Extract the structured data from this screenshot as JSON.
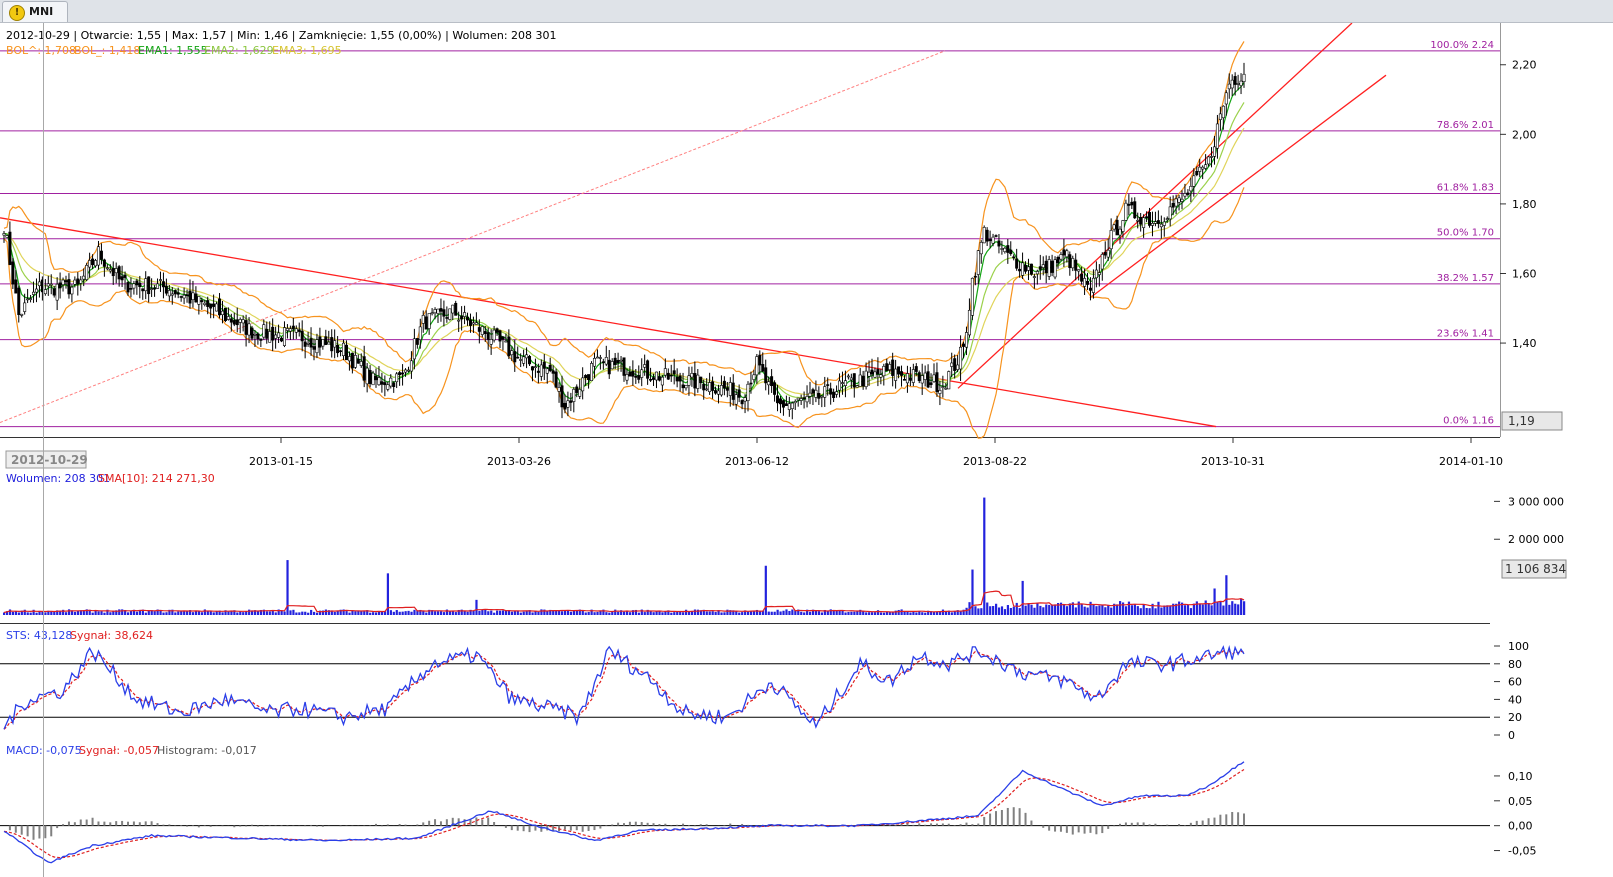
{
  "tab": {
    "label": "MNI",
    "icon": "warning-icon"
  },
  "colors": {
    "bol": "#f7931e",
    "ema1": "#13a313",
    "ema2": "#9bd14b",
    "ema3": "#e0d45a",
    "fib": "#a020a0",
    "trend": "#ff2020",
    "volume": "#2222dd",
    "sma": "#e02020",
    "sts": "#2a3ee8",
    "signal": "#e02020",
    "hist": "#808080"
  },
  "price_info": {
    "line1": "2012-10-29 | Otwarcie: 1,55 | Max: 1,57 | Min: 1,46 | Zamknięcie: 1,55 (0,00%) | Wolumen: 208 301",
    "bol_up": "BOL^: 1,708",
    "bol_down": "BOL_: 1,418",
    "ema1": "EMA1: 1,555",
    "ema2": "EMA2: 1,629",
    "ema3": "EMA3: 1,695"
  },
  "volume_info": {
    "volume": "Wolumen: 208 301",
    "sma": "SMA[10]: 214 271,30"
  },
  "sts_info": {
    "sts": "STS: 43,128",
    "signal": "Sygnał: 38,624"
  },
  "macd_info": {
    "macd": "MACD: -0,075",
    "signal": "Sygnał: -0,057",
    "histogram": "Histogram: -0,017"
  },
  "cursor_date": "2012-10-29",
  "price_marker": "1,19",
  "volume_marker": "1 106 834",
  "chart_data": [
    {
      "type": "candlestick",
      "name": "price",
      "x_ticks": [
        "2013-01-15",
        "2013-03-26",
        "2013-06-12",
        "2013-08-22",
        "2013-10-31",
        "2014-01-10"
      ],
      "y_ticks": [
        "1,40",
        "1,60",
        "1,80",
        "2,00",
        "2,20"
      ],
      "ylim": [
        1.13,
        2.32
      ],
      "fib_levels": [
        {
          "label": "100.0% 2.24",
          "value": 2.24
        },
        {
          "label": "78.6% 2.01",
          "value": 2.01
        },
        {
          "label": "61.8% 1.83",
          "value": 1.83
        },
        {
          "label": "50.0% 1.70",
          "value": 1.7
        },
        {
          "label": "38.2% 1.57",
          "value": 1.57
        },
        {
          "label": "23.6% 1.41",
          "value": 1.41
        },
        {
          "label": "0.0% 1.16",
          "value": 1.16
        }
      ],
      "close_keyframes": [
        [
          0,
          1.74
        ],
        [
          5,
          1.48
        ],
        [
          12,
          1.56
        ],
        [
          25,
          1.56
        ],
        [
          32,
          1.66
        ],
        [
          40,
          1.57
        ],
        [
          55,
          1.56
        ],
        [
          70,
          1.5
        ],
        [
          85,
          1.43
        ],
        [
          100,
          1.42
        ],
        [
          115,
          1.38
        ],
        [
          125,
          1.29
        ],
        [
          135,
          1.3
        ],
        [
          142,
          1.46
        ],
        [
          152,
          1.49
        ],
        [
          165,
          1.42
        ],
        [
          175,
          1.35
        ],
        [
          185,
          1.32
        ],
        [
          190,
          1.22
        ],
        [
          200,
          1.34
        ],
        [
          210,
          1.33
        ],
        [
          225,
          1.3
        ],
        [
          240,
          1.28
        ],
        [
          250,
          1.25
        ],
        [
          255,
          1.34
        ],
        [
          262,
          1.22
        ],
        [
          275,
          1.24
        ],
        [
          285,
          1.28
        ],
        [
          300,
          1.32
        ],
        [
          310,
          1.3
        ],
        [
          318,
          1.28
        ],
        [
          325,
          1.38
        ],
        [
          328,
          1.58
        ],
        [
          332,
          1.72
        ],
        [
          340,
          1.65
        ],
        [
          350,
          1.6
        ],
        [
          360,
          1.65
        ],
        [
          368,
          1.54
        ],
        [
          373,
          1.67
        ],
        [
          380,
          1.78
        ],
        [
          390,
          1.75
        ],
        [
          400,
          1.82
        ],
        [
          408,
          1.92
        ],
        [
          415,
          2.15
        ],
        [
          420,
          2.18
        ]
      ],
      "notes": [
        "BOL",
        "EMA1",
        "EMA2",
        "EMA3",
        "trend lines"
      ]
    },
    {
      "type": "bar",
      "name": "volume",
      "y_ticks": [
        "2 000 000",
        "3 000 000"
      ],
      "ylim": [
        0,
        3300000
      ],
      "spikes": [
        [
          96,
          1450000
        ],
        [
          130,
          1100000
        ],
        [
          160,
          400000
        ],
        [
          258,
          1300000
        ],
        [
          328,
          1200000
        ],
        [
          332,
          3100000
        ],
        [
          345,
          900000
        ],
        [
          410,
          700000
        ],
        [
          414,
          1050000
        ]
      ]
    },
    {
      "type": "line",
      "name": "STS",
      "y_ticks": [
        "0",
        "20",
        "40",
        "60",
        "80",
        "100"
      ],
      "ylim": [
        0,
        100
      ],
      "levels": [
        20,
        80
      ],
      "keyframes": [
        [
          0,
          10
        ],
        [
          8,
          40
        ],
        [
          20,
          50
        ],
        [
          30,
          95
        ],
        [
          45,
          40
        ],
        [
          60,
          25
        ],
        [
          75,
          40
        ],
        [
          90,
          25
        ],
        [
          100,
          30
        ],
        [
          115,
          20
        ],
        [
          130,
          30
        ],
        [
          145,
          80
        ],
        [
          160,
          90
        ],
        [
          172,
          40
        ],
        [
          185,
          30
        ],
        [
          195,
          20
        ],
        [
          205,
          95
        ],
        [
          220,
          60
        ],
        [
          230,
          25
        ],
        [
          245,
          20
        ],
        [
          260,
          60
        ],
        [
          275,
          10
        ],
        [
          290,
          80
        ],
        [
          300,
          60
        ],
        [
          310,
          90
        ],
        [
          320,
          80
        ],
        [
          330,
          95
        ],
        [
          345,
          70
        ],
        [
          360,
          60
        ],
        [
          370,
          40
        ],
        [
          380,
          80
        ],
        [
          395,
          80
        ],
        [
          410,
          90
        ],
        [
          415,
          95
        ],
        [
          420,
          88
        ]
      ]
    },
    {
      "type": "line",
      "name": "MACD",
      "y_ticks": [
        "-0,05",
        "0,00",
        "0,05",
        "0,10"
      ],
      "ylim": [
        -0.075,
        0.13
      ],
      "keyframes": [
        [
          0,
          -0.01
        ],
        [
          15,
          -0.075
        ],
        [
          30,
          -0.04
        ],
        [
          50,
          -0.02
        ],
        [
          80,
          -0.025
        ],
        [
          110,
          -0.03
        ],
        [
          140,
          -0.025
        ],
        [
          165,
          0.03
        ],
        [
          180,
          0.0
        ],
        [
          200,
          -0.03
        ],
        [
          215,
          -0.01
        ],
        [
          240,
          -0.005
        ],
        [
          260,
          0.0
        ],
        [
          290,
          0.0
        ],
        [
          310,
          0.01
        ],
        [
          330,
          0.02
        ],
        [
          345,
          0.11
        ],
        [
          360,
          0.07
        ],
        [
          372,
          0.04
        ],
        [
          385,
          0.06
        ],
        [
          400,
          0.06
        ],
        [
          408,
          0.08
        ],
        [
          420,
          0.13
        ]
      ]
    }
  ]
}
